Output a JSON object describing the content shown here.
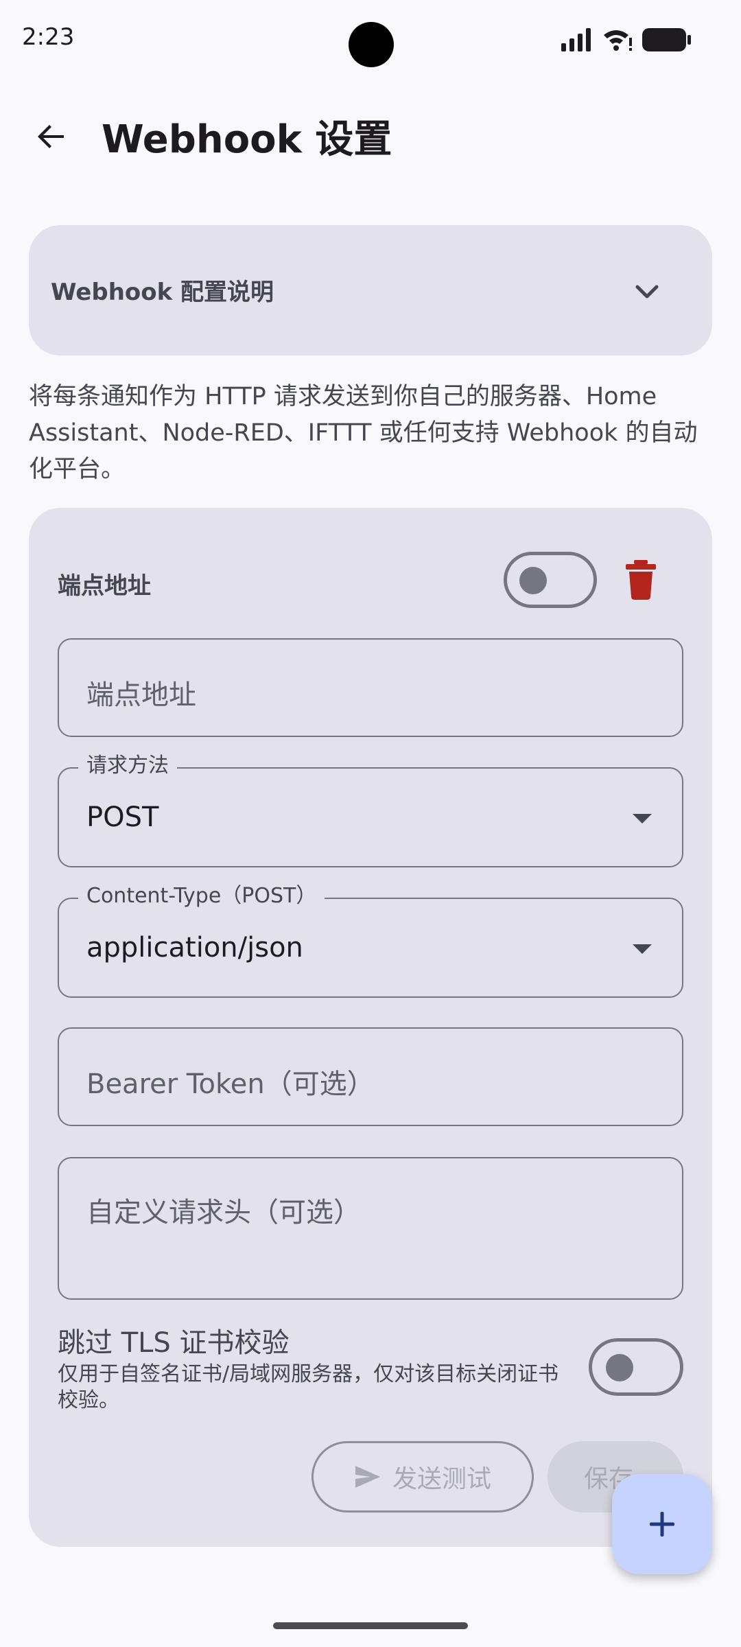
{
  "status_bar": {
    "time": "2:23"
  },
  "app_bar": {
    "title": "Webhook 设置"
  },
  "info_card": {
    "title": "Webhook 配置说明"
  },
  "description": "将每条通知作为 HTTP 请求发送到你自己的服务器、Home Assistant、Node-RED、IFTTT 或任何支持 Webhook 的自动化平台。",
  "endpoint_card": {
    "label": "端点地址",
    "enabled": false,
    "fields": {
      "endpoint": {
        "placeholder": "端点地址",
        "value": ""
      },
      "method": {
        "label": "请求方法",
        "value": "POST"
      },
      "content_type": {
        "label": "Content-Type（POST）",
        "value": "application/json"
      },
      "bearer_token": {
        "placeholder": "Bearer Token（可选）",
        "value": ""
      },
      "custom_headers": {
        "placeholder": "自定义请求头（可选）",
        "value": ""
      }
    },
    "tls": {
      "title": "跳过 TLS 证书校验",
      "subtitle": "仅用于自签名证书/局域网服务器，仅对该目标关闭证书校验。",
      "enabled": false
    },
    "buttons": {
      "send_test": "发送测试",
      "save": "保存"
    }
  },
  "colors": {
    "accent_fab": "#c6d3ff",
    "delete_red": "#b3261e",
    "card_bg": "#e3e2ec"
  }
}
